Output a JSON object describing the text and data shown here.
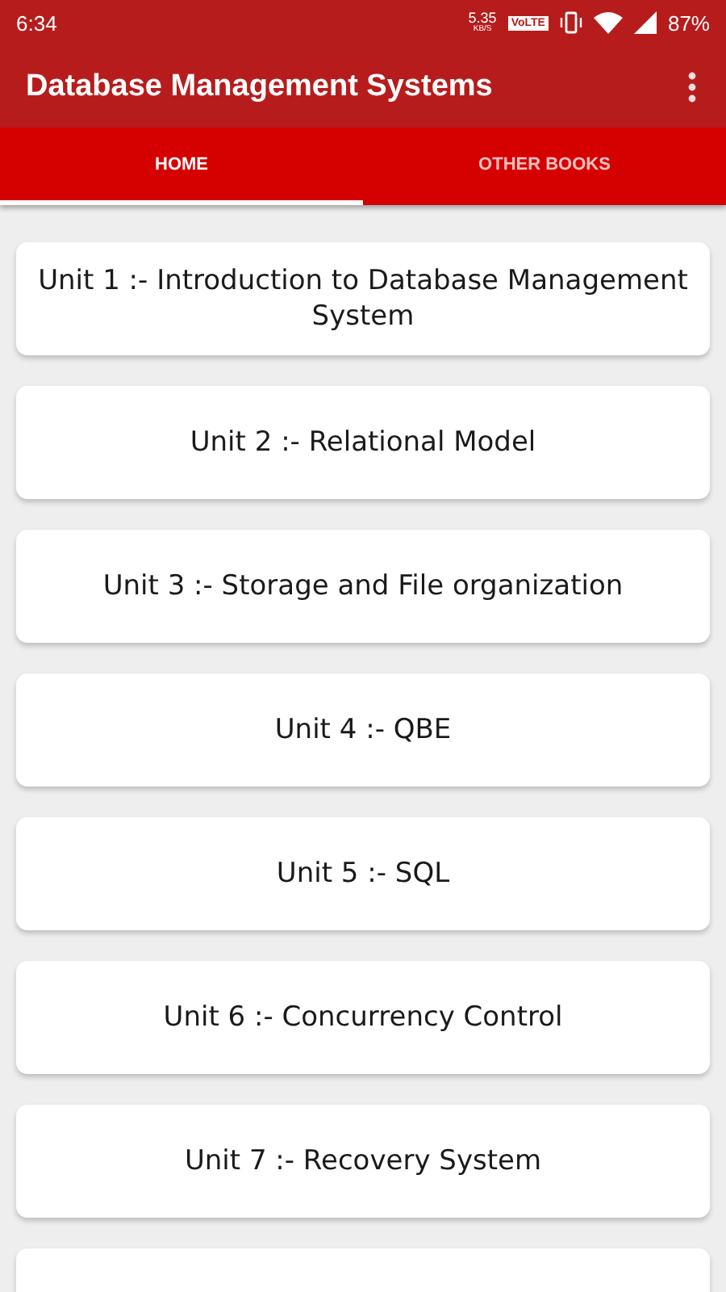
{
  "status_bar": {
    "time": "6:34",
    "speed": "5.35",
    "speed_unit": "KB/S",
    "volte": "VoLTE",
    "battery": "87%"
  },
  "app_bar": {
    "title": "Database Management Systems"
  },
  "tabs": [
    {
      "label": "HOME",
      "selected": true
    },
    {
      "label": "OTHER BOOKS",
      "selected": false
    }
  ],
  "units": [
    {
      "kind": "unit",
      "label": "Unit 1 :- Introduction to Database Management System"
    },
    {
      "kind": "unit",
      "label": "Unit 2 :- Relational Model"
    },
    {
      "kind": "unit",
      "label": "Unit 3 :- Storage and File organization"
    },
    {
      "kind": "unit",
      "label": "Unit 4 :- QBE"
    },
    {
      "kind": "unit",
      "label": "Unit 5 :- SQL"
    },
    {
      "kind": "unit",
      "label": "Unit 6 :- Concurrency Control"
    },
    {
      "kind": "unit",
      "label": "Unit 7 :- Recovery System"
    },
    {
      "kind": "partial"
    }
  ]
}
